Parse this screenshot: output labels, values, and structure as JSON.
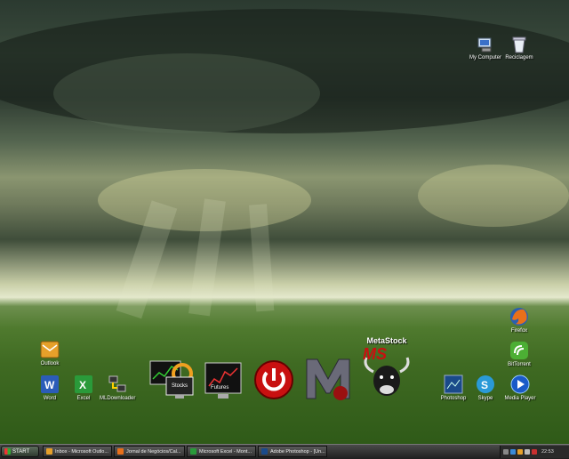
{
  "desktop_icons": {
    "my_computer": "My Computer",
    "recycle_bin": "Reciclagem",
    "firefox": "Firefox",
    "bittorrent": "BitTorrent",
    "outlook": "Outlook",
    "word": "Word",
    "excel": "Excel",
    "mldownloader": "MLDownloader",
    "stocks": "Stocks",
    "futures": "Futures",
    "metastock": "MetaStock",
    "metastock_badge": "MS",
    "photoshop": "Photoshop",
    "skype": "Skype",
    "media_player": "Media Player"
  },
  "taskbar": {
    "start_label": "START",
    "tasks": [
      "Inbox - Microsoft Outlo...",
      "Jornal de Negócios/Cal...",
      "Microsoft Excel - Mont...",
      "Adobe Photoshop - [Un..."
    ],
    "clock": "22:53"
  },
  "colors": {
    "accent": "#3f6a22",
    "taskbar": "#2a2a2a"
  }
}
